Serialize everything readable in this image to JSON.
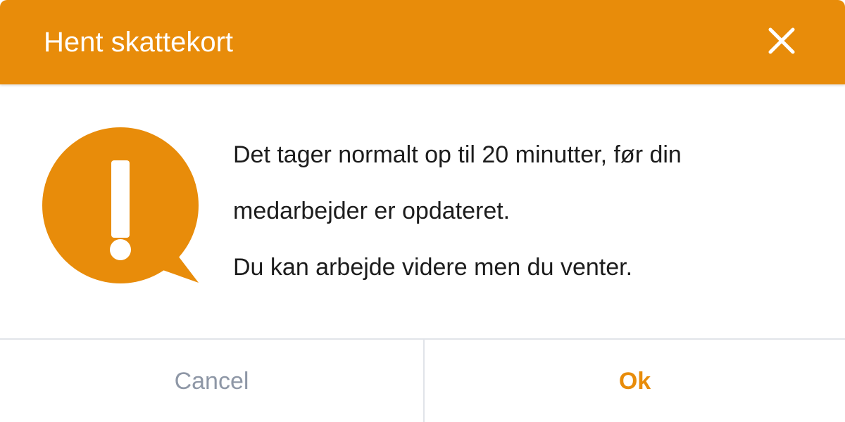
{
  "colors": {
    "accent": "#e88c0a",
    "text": "#1c1c1c",
    "muted": "#8e97a6",
    "divider": "#e1e4e9"
  },
  "dialog": {
    "title": "Hent skattekort",
    "close_icon": "close-icon",
    "alert_icon": "exclamation-speech-bubble-icon",
    "message_lines": [
      "Det tager normalt op til 20 minutter, før din",
      "medarbejder er opdateret.",
      "Du kan arbejde videre men du venter."
    ]
  },
  "buttons": {
    "cancel_label": "Cancel",
    "ok_label": "Ok"
  }
}
